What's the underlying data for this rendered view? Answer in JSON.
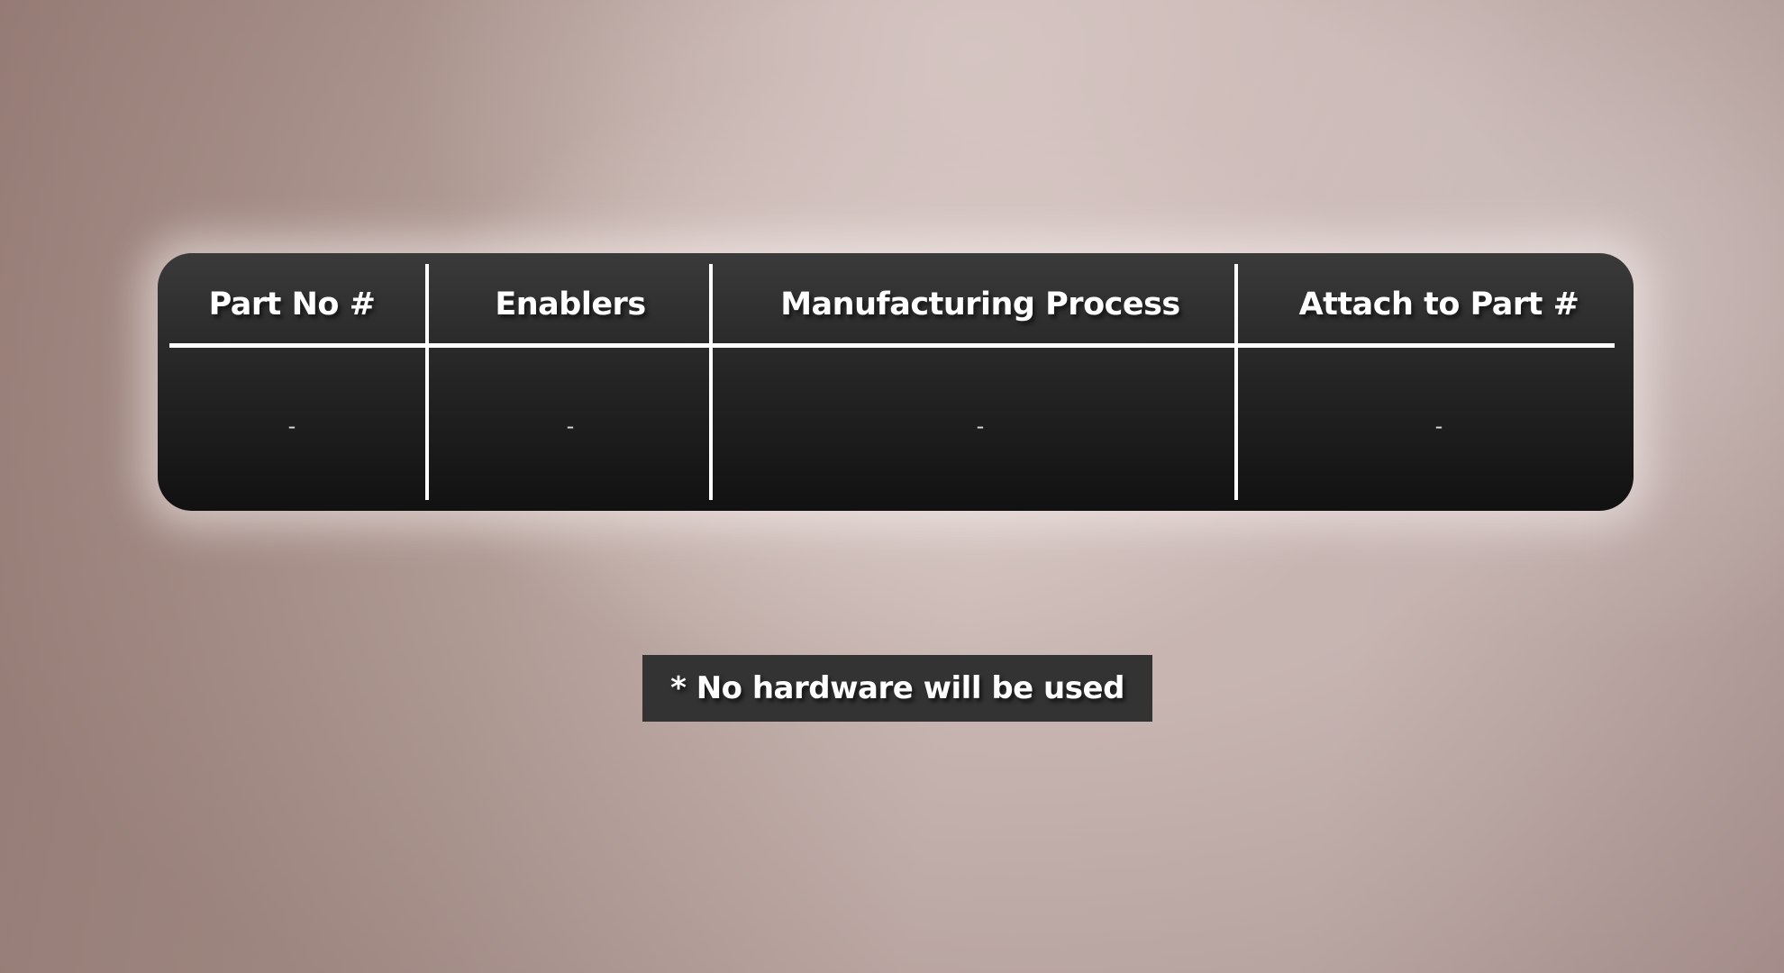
{
  "table": {
    "headers": [
      "Part No #",
      "Enablers",
      "Manufacturing Process",
      "Attach to Part #"
    ],
    "rows": [
      [
        "-",
        "-",
        "-",
        "-"
      ]
    ]
  },
  "note": {
    "text": "* No hardware will be used"
  },
  "colors": {
    "panel": "#1e1e1e",
    "note_background": "#333333",
    "text": "#ffffff",
    "background": "#c2afab"
  }
}
